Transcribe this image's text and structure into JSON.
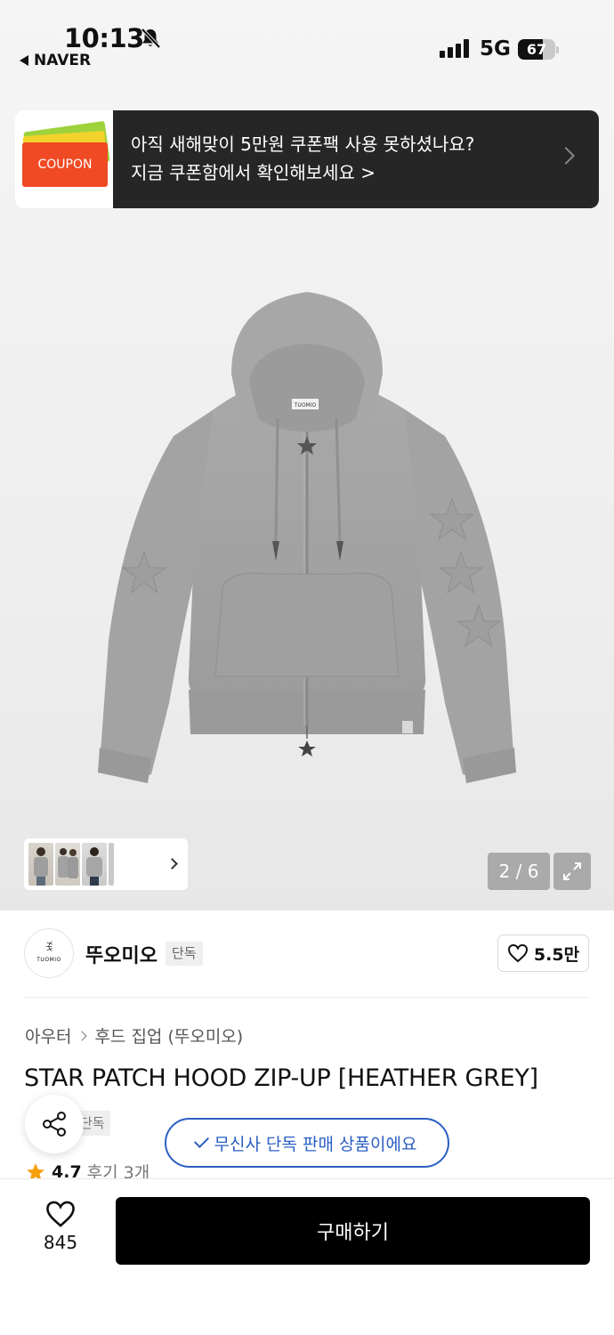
{
  "status_bar": {
    "time": "10:13",
    "back_app": "NAVER",
    "network": "5G",
    "battery": "67",
    "battery_level": 0.67
  },
  "banner": {
    "coupon_label": "COUPON",
    "line1": "아직 새해맞이 5만원 쿠폰팩 사용 못하셨나요?",
    "line2": "지금 쿠폰함에서 확인해보세요 >"
  },
  "gallery": {
    "counter": "2 / 6",
    "logo_text": "TUOMIO"
  },
  "brand": {
    "name": "뚜오미오",
    "badge": "단독",
    "logo_text": "TUOMIO",
    "likes": "5.5만"
  },
  "product": {
    "breadcrumb": [
      "아우터",
      "후드 집업 (뚜오미오)"
    ],
    "title": "STAR PATCH HOOD ZIP-UP [HEATHER GREY]",
    "badge": "단독",
    "rating": "4.7",
    "reviews": "후기 3개"
  },
  "toast": {
    "text": "무신사 단독 판매 상품이에요"
  },
  "bottom": {
    "wish_count": "845",
    "buy_label": "구매하기"
  },
  "colors": {
    "accent_blue": "#2a5ec4",
    "star": "#f59f0b",
    "coupon_red": "#f04a24",
    "banner_bg": "#262626"
  }
}
